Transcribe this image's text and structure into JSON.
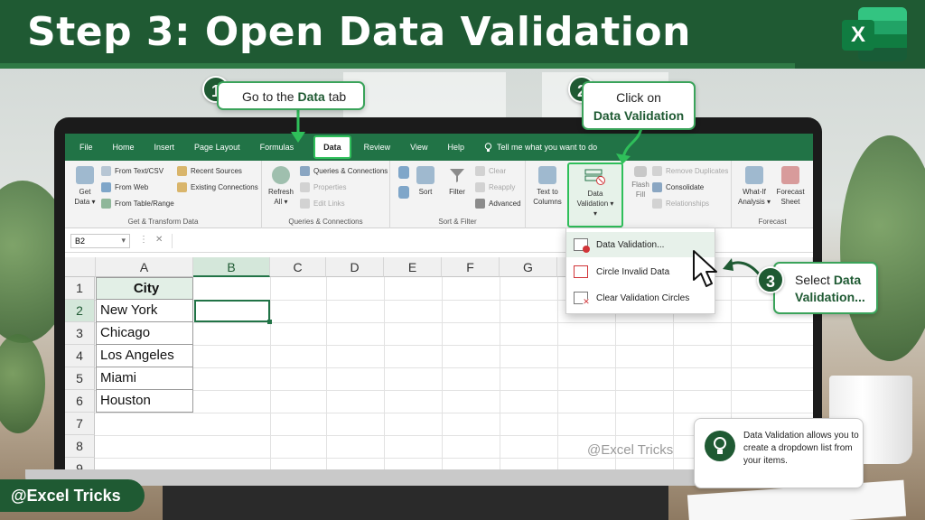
{
  "title": "Step 3: Open Data Validation",
  "brand": "@Excel Tricks",
  "logo": {
    "letter": "X"
  },
  "colors": {
    "brand_green": "#1f5a33",
    "excel_green": "#217346",
    "highlight_green": "#2fbf5a"
  },
  "callouts": [
    {
      "number": "1",
      "text_pre": "Go to the ",
      "text_bold": "Data",
      "text_post": " tab"
    },
    {
      "number": "2",
      "line1": "Click on",
      "line2": "Data Validation"
    },
    {
      "number": "3",
      "line1_pre": "Select ",
      "line1_bold": "Data",
      "line2": "Validation..."
    }
  ],
  "tip": {
    "icon": "lightbulb-icon",
    "text": "Data Validation allows you to create a dropdown list from your items."
  },
  "excel": {
    "tabs": [
      "File",
      "Home",
      "Insert",
      "Page Layout",
      "Formulas",
      "Data",
      "Review",
      "View",
      "Help"
    ],
    "active_tab": "Data",
    "tell_me": "Tell me what you want to do",
    "ribbon": {
      "get_data": {
        "line1": "Get",
        "line2": "Data ▾"
      },
      "from_text": "From Text/CSV",
      "from_web": "From Web",
      "from_table": "From Table/Range",
      "recent_sources": "Recent Sources",
      "existing_connections": "Existing Connections",
      "group1": "Get & Transform Data",
      "refresh": {
        "line1": "Refresh",
        "line2": "All ▾"
      },
      "queries": "Queries & Connections",
      "properties": "Properties",
      "edit_links": "Edit Links",
      "group2": "Queries & Connections",
      "sort": "Sort",
      "filter": "Filter",
      "clear": "Clear",
      "reapply": "Reapply",
      "advanced": "Advanced",
      "group3": "Sort & Filter",
      "text_to_columns": {
        "line1": "Text to",
        "line2": "Columns"
      },
      "data_validation": {
        "line1": "Data",
        "line2": "Validation ▾",
        "line3": "▾"
      },
      "remove_duplicates": "Remove Duplicates",
      "consolidate": "Consolidate",
      "relationships": "Relationships",
      "flash_fill": {
        "line1": "Flash",
        "line2": "Fill"
      },
      "whatif": {
        "line1": "What-If",
        "line2": "Analysis ▾"
      },
      "forecast_sheet": {
        "line1": "Forecast",
        "line2": "Sheet"
      },
      "group5": "Forecast"
    },
    "name_box": "B2",
    "columns": [
      "A",
      "B",
      "C",
      "D",
      "E",
      "F",
      "G"
    ],
    "rows": [
      "1",
      "2",
      "3",
      "4",
      "5",
      "6",
      "7",
      "8",
      "9"
    ],
    "cells": {
      "header": "City",
      "values": [
        "New York",
        "Chicago",
        "Los Angeles",
        "Miami",
        "Houston"
      ]
    },
    "watermark": "@Excel Tricks",
    "menu": [
      {
        "label": "Data Validation...",
        "icon": "data-validation-icon"
      },
      {
        "label": "Circle Invalid Data",
        "icon": "circle-invalid-icon"
      },
      {
        "label": "Clear Validation Circles",
        "icon": "clear-circles-icon"
      }
    ]
  }
}
